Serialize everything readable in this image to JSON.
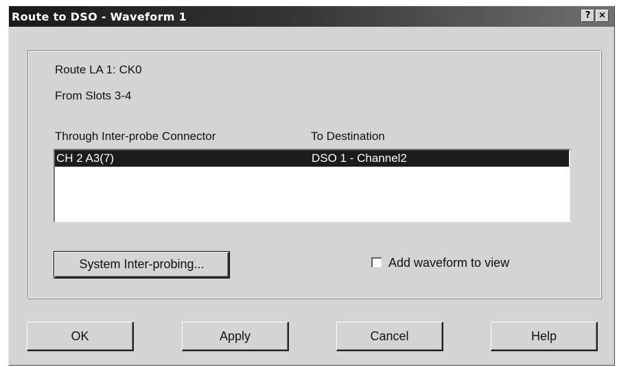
{
  "window": {
    "title": "Route to DSO - Waveform 1",
    "help_glyph": "?",
    "close_glyph": "×"
  },
  "route": {
    "line1": "Route LA 1: CK0",
    "line2": "From Slots 3-4"
  },
  "list": {
    "columns": [
      "Through Inter-probe Connector",
      "To Destination"
    ],
    "rows": [
      {
        "connector": "CH 2 A3(7)",
        "destination": "DSO 1 - Channel2",
        "selected": true
      }
    ]
  },
  "buttons": {
    "system_interprobing": "System Inter-probing...",
    "ok": "OK",
    "apply": "Apply",
    "cancel": "Cancel",
    "help": "Help"
  },
  "add_waveform": {
    "label": "Add waveform to view",
    "checked": false
  }
}
